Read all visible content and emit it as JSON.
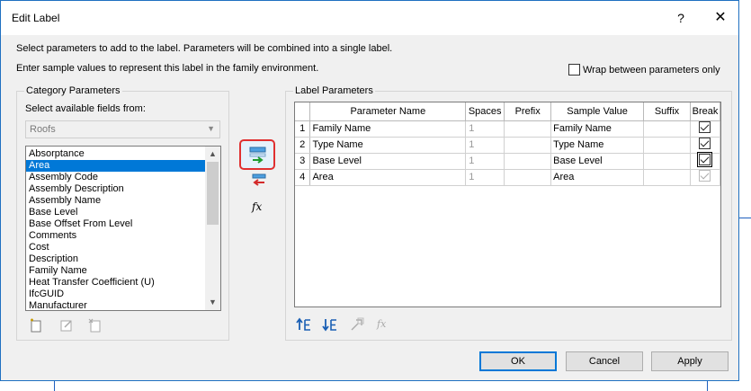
{
  "dialog": {
    "title": "Edit Label",
    "help_label": "?",
    "close_label": "✕",
    "instruction_1": "Select parameters to add to the label.  Parameters will be combined into a single label.",
    "instruction_2": "Enter sample values to represent this label in the family environment.",
    "wrap_label": "Wrap between parameters only",
    "wrap_checked": false
  },
  "category": {
    "group_label": "Category Parameters",
    "fields_label": "Select available fields from:",
    "category_value": "Roofs",
    "items": [
      "Absorptance",
      "Area",
      "Assembly Code",
      "Assembly Description",
      "Assembly Name",
      "Base Level",
      "Base Offset From Level",
      "Comments",
      "Cost",
      "Description",
      "Family Name",
      "Heat Transfer Coefficient (U)",
      "IfcGUID",
      "Manufacturer"
    ],
    "selected_item": "Area"
  },
  "middle_tools": {
    "add_icon": "add-parameter-icon",
    "remove_icon": "remove-parameter-icon",
    "formula_label": "fx"
  },
  "label_params": {
    "group_label": "Label Parameters",
    "columns": [
      "",
      "Parameter Name",
      "Spaces",
      "Prefix",
      "Sample Value",
      "Suffix",
      "Break"
    ],
    "rows": [
      {
        "num": "1",
        "name": "Family Name",
        "spaces": "1",
        "prefix": "",
        "sample": "Family Name",
        "suffix": "",
        "break": true
      },
      {
        "num": "2",
        "name": "Type Name",
        "spaces": "1",
        "prefix": "",
        "sample": "Type Name",
        "suffix": "",
        "break": true
      },
      {
        "num": "3",
        "name": "Base Level",
        "spaces": "1",
        "prefix": "",
        "sample": "Base Level",
        "suffix": "",
        "break": true
      },
      {
        "num": "4",
        "name": "Area",
        "spaces": "1",
        "prefix": "",
        "sample": "Area",
        "suffix": "",
        "break": true
      }
    ]
  },
  "buttons": {
    "ok": "OK",
    "cancel": "Cancel",
    "apply": "Apply"
  }
}
